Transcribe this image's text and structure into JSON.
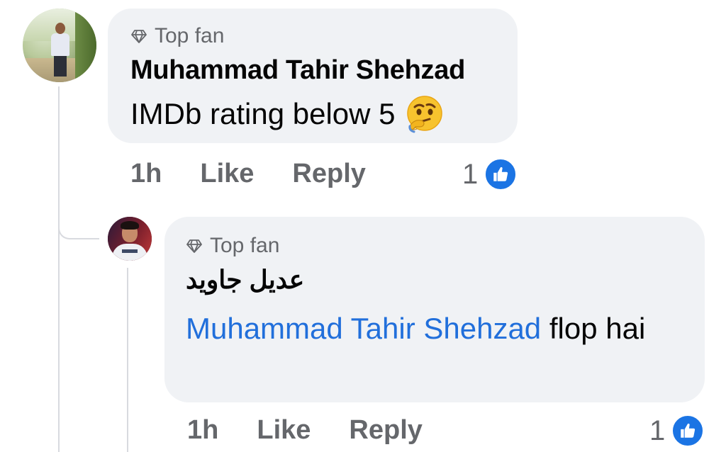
{
  "comments": [
    {
      "badge": "Top fan",
      "author": "Muhammad Tahir Shehzad",
      "text": "IMDb rating below 5",
      "emoji": "thinking-face",
      "time": "1h",
      "like_label": "Like",
      "reply_label": "Reply",
      "reaction_count": "1",
      "reaction_icon": "thumbs-up-icon"
    },
    {
      "badge": "Top fan",
      "author": "عدیل جاوید",
      "mention": "Muhammad Tahir Shehzad",
      "text": "flop hai",
      "time": "1h",
      "like_label": "Like",
      "reply_label": "Reply",
      "reaction_count": "1",
      "reaction_icon": "thumbs-up-icon"
    }
  ],
  "colors": {
    "bubble_bg": "#f0f2f5",
    "secondary_text": "#65676b",
    "mention": "#216fdb",
    "like_blue": "#1b74e4",
    "thread_line": "#d8dadf"
  }
}
